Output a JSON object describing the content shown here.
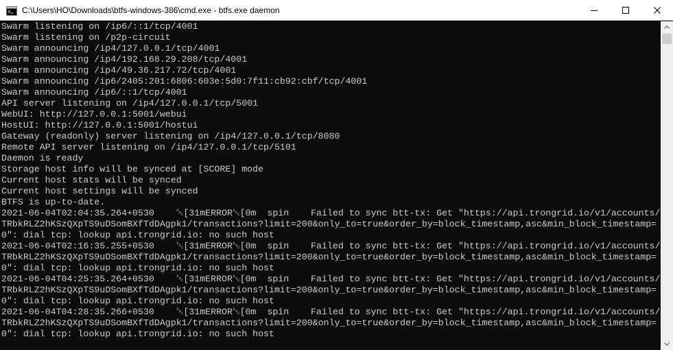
{
  "window": {
    "title": "C:\\Users\\HO\\Downloads\\btfs-windows-386\\cmd.exe - btfs.exe  daemon",
    "app_icon": "cmd-icon",
    "controls": {
      "minimize_icon": "minimize-icon",
      "maximize_icon": "maximize-icon",
      "close_icon": "close-icon"
    }
  },
  "colors": {
    "console_background": "#0c0c0c",
    "console_text": "#cccccc",
    "titlebar_background": "#ffffff",
    "scrollbar_track": "#f0f0f0",
    "scrollbar_thumb": "#cdcdcd"
  },
  "console": {
    "lines": [
      "Swarm listening on /ip6/::1/tcp/4001",
      "Swarm listening on /p2p-circuit",
      "Swarm announcing /ip4/127.0.0.1/tcp/4001",
      "Swarm announcing /ip4/192.168.29.208/tcp/4001",
      "Swarm announcing /ip4/49.36.217.72/tcp/4001",
      "Swarm announcing /ip6/2405:201:6806:603e:5d0:7f11:cb92:cbf/tcp/4001",
      "Swarm announcing /ip6/::1/tcp/4001",
      "API server listening on /ip4/127.0.0.1/tcp/5001",
      "WebUI: http://127.0.0.1:5001/webui",
      "HostUI: http://127.0.0.1:5001/hostui",
      "Gateway (readonly) server listening on /ip4/127.0.0.1/tcp/8080",
      "Remote API server listening on /ip4/127.0.0.1/tcp/5101",
      "Daemon is ready",
      "Storage host info will be synced at [SCORE] mode",
      "Current host stats will be synced",
      "Current host settings will be synced",
      "BTFS is up-to-date.",
      "2021-06-04T02:04:35.264+0530    ␛[31mERROR␛[0m  spin    Failed to sync btt-tx: Get \"https://api.trongrid.io/v1/accounts/",
      "TRbkRLZ2hKSzQXpTS9uDSomBXfTdDAgpk1/transactions?limit=200&only_to=true&order_by=block_timestamp,asc&min_block_timestamp=",
      "0\": dial tcp: lookup api.trongrid.io: no such host",
      "2021-06-04T02:16:35.255+0530    ␛[31mERROR␛[0m  spin    Failed to sync btt-tx: Get \"https://api.trongrid.io/v1/accounts/",
      "TRbkRLZ2hKSzQXpTS9uDSomBXfTdDAgpk1/transactions?limit=200&only_to=true&order_by=block_timestamp,asc&min_block_timestamp=",
      "0\": dial tcp: lookup api.trongrid.io: no such host",
      "2021-06-04T04:25:35.264+0530    ␛[31mERROR␛[0m  spin    Failed to sync btt-tx: Get \"https://api.trongrid.io/v1/accounts/",
      "TRbkRLZ2hKSzQXpTS9uDSomBXfTdDAgpk1/transactions?limit=200&only_to=true&order_by=block_timestamp,asc&min_block_timestamp=",
      "0\": dial tcp: lookup api.trongrid.io: no such host",
      "2021-06-04T04:28:35.266+0530    ␛[31mERROR␛[0m  spin    Failed to sync btt-tx: Get \"https://api.trongrid.io/v1/accounts/",
      "TRbkRLZ2hKSzQXpTS9uDSomBXfTdDAgpk1/transactions?limit=200&only_to=true&order_by=block_timestamp,asc&min_block_timestamp=",
      "0\": dial tcp: lookup api.trongrid.io: no such host"
    ]
  },
  "scrollbar": {
    "up_icon": "scroll-up-arrow-icon",
    "down_icon": "scroll-down-arrow-icon"
  }
}
